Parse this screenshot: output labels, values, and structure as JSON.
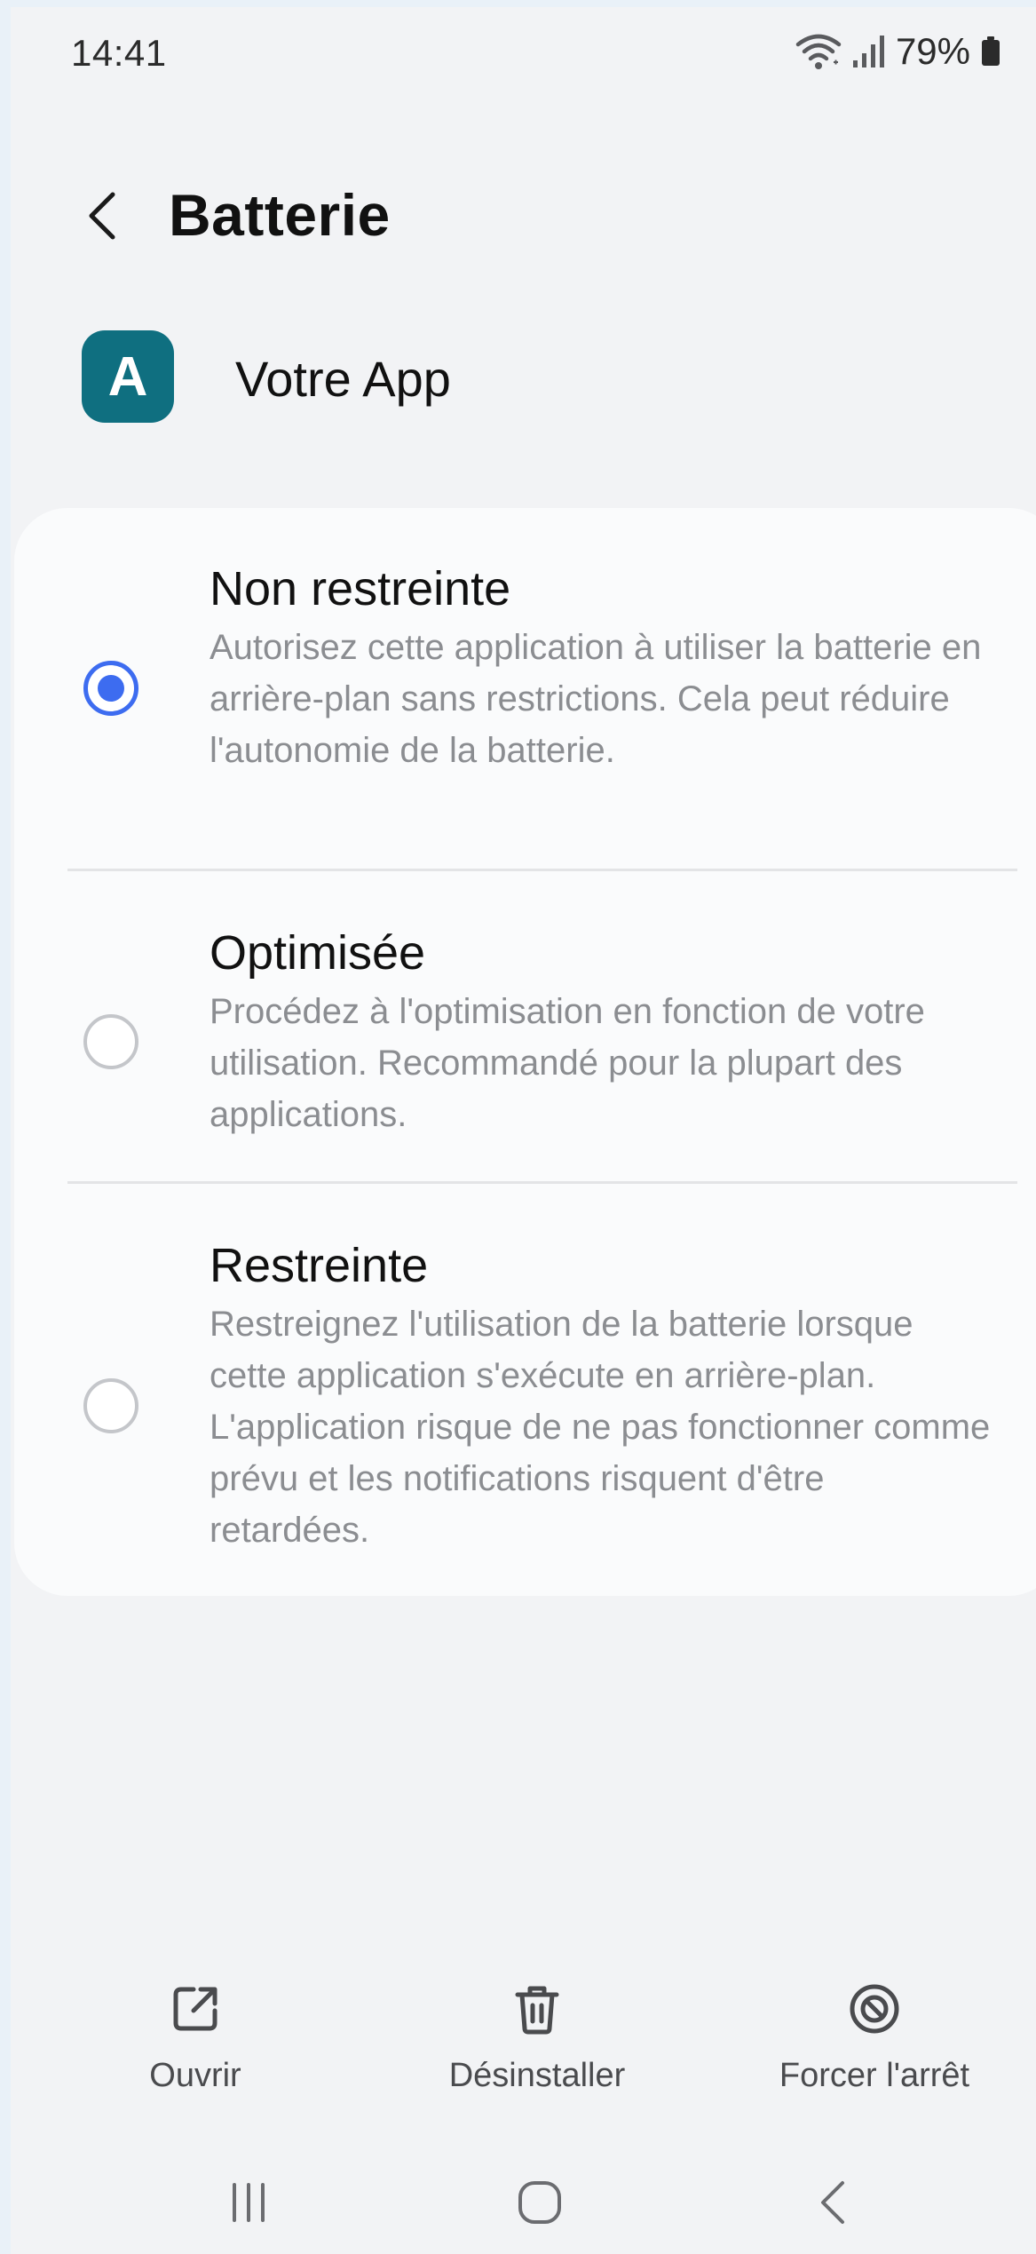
{
  "status_bar": {
    "time": "14:41",
    "battery_percent": "79%",
    "icons": [
      "wifi-icon",
      "signal-icon",
      "battery-icon"
    ]
  },
  "header": {
    "title": "Batterie",
    "back_icon": "chevron-left-icon"
  },
  "app": {
    "icon_letter": "A",
    "icon_color": "#0f6f80",
    "name": "Votre App"
  },
  "options": [
    {
      "title": "Non restreinte",
      "description": "Autorisez cette application à utiliser la batterie en arrière-plan sans restrictions. Cela peut réduire l'autonomie de la batterie.",
      "selected": true
    },
    {
      "title": "Optimisée",
      "description": "Procédez à l'optimisation en fonction de votre utilisation. Recommandé pour la plupart des applications.",
      "selected": false
    },
    {
      "title": "Restreinte",
      "description": "Restreignez l'utilisation de la batterie lorsque cette application s'exécute en arrière-plan. L'application risque de ne pas fonctionner comme prévu et les notifications risquent d'être retardées.",
      "selected": false
    }
  ],
  "accent_color": "#3d6cf0",
  "actions": [
    {
      "label": "Ouvrir",
      "icon": "open-external-icon"
    },
    {
      "label": "Désinstaller",
      "icon": "trash-icon"
    },
    {
      "label": "Forcer l'arrêt",
      "icon": "stop-icon"
    }
  ],
  "nav_bar": {
    "buttons": [
      "recent-apps-icon",
      "home-icon",
      "back-icon"
    ]
  }
}
